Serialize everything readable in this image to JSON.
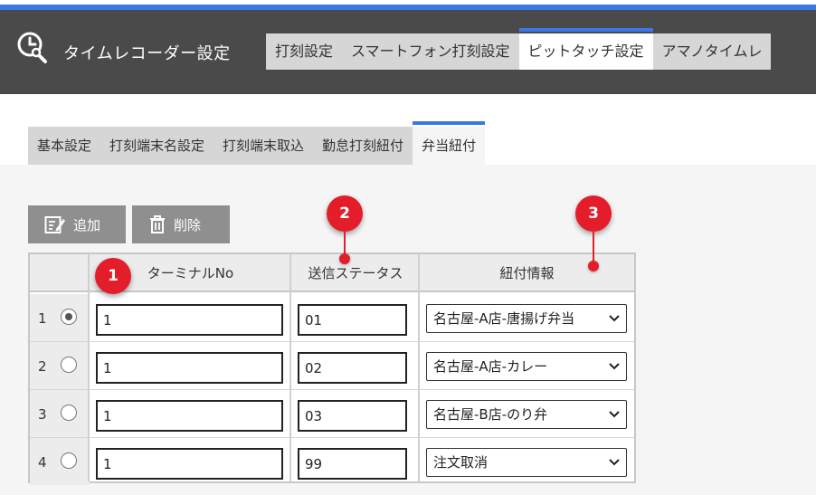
{
  "header": {
    "title": "タイムレコーダー設定",
    "icon": "clock-wrench-icon",
    "tabs": [
      {
        "label": "打刻設定"
      },
      {
        "label": "スマートフォン打刻設定"
      },
      {
        "label": "ピットタッチ設定"
      },
      {
        "label": "アマノタイムレ"
      }
    ],
    "active_tab": "ピットタッチ設定"
  },
  "sub_tabs": {
    "items": [
      {
        "label": "基本設定"
      },
      {
        "label": "打刻端末名設定"
      },
      {
        "label": "打刻端末取込"
      },
      {
        "label": "勤怠打刻紐付"
      },
      {
        "label": "弁当紐付"
      }
    ],
    "active": "弁当紐付"
  },
  "toolbar": {
    "add_label": "追加",
    "delete_label": "削除"
  },
  "table": {
    "columns": [
      "ターミナルNo",
      "送信ステータス",
      "紐付情報"
    ],
    "rows": [
      {
        "index": "1",
        "selected": true,
        "terminal_no": "1",
        "status": "01",
        "link": "名古屋-A店-唐揚げ弁当"
      },
      {
        "index": "2",
        "selected": false,
        "terminal_no": "1",
        "status": "02",
        "link": "名古屋-A店-カレー"
      },
      {
        "index": "3",
        "selected": false,
        "terminal_no": "1",
        "status": "03",
        "link": "名古屋-B店-のり弁"
      },
      {
        "index": "4",
        "selected": false,
        "terminal_no": "1",
        "status": "99",
        "link": "注文取消"
      }
    ]
  },
  "callouts": [
    "1",
    "2",
    "3"
  ],
  "colors": {
    "header_bg": "#4a4a4a",
    "accent": "#3b78e7",
    "button_bg": "#8f8f8f",
    "callout": "#e31d2a"
  }
}
